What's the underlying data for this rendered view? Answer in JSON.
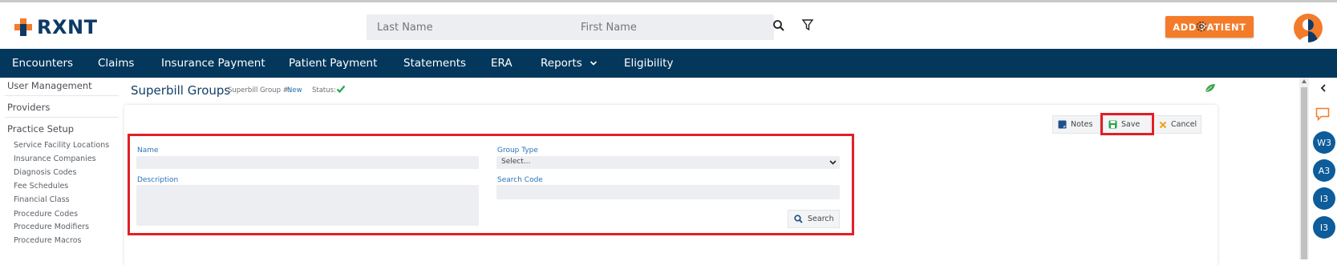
{
  "header": {
    "logo_text": "RXNT",
    "last_name_placeholder": "Last Name",
    "first_name_placeholder": "First Name",
    "add_patient_label": "ADD PATIENT"
  },
  "nav": {
    "items": [
      "Encounters",
      "Claims",
      "Insurance Payment",
      "Patient Payment",
      "Statements",
      "ERA",
      "Reports",
      "Eligibility"
    ]
  },
  "sidebar": {
    "sections": [
      "User Management",
      "Providers",
      "Practice Setup"
    ],
    "sub_items": [
      "Service Facility Locations",
      "Insurance Companies",
      "Diagnosis Codes",
      "Fee Schedules",
      "Financial Class",
      "Procedure Codes",
      "Procedure Modifiers",
      "Procedure Macros"
    ]
  },
  "page": {
    "title": "Superbill Groups",
    "group_num_label": "Superbill Group #:",
    "group_num_value": "New",
    "status_label": "Status:"
  },
  "toolbar": {
    "notes_label": "Notes",
    "save_label": "Save",
    "cancel_label": "Cancel"
  },
  "form": {
    "name_label": "Name",
    "name_value": "",
    "description_label": "Description",
    "description_value": "",
    "group_type_label": "Group Type",
    "group_type_value": "Select...",
    "search_code_label": "Search Code",
    "search_code_value": "",
    "search_button_label": "Search"
  },
  "right_rail": {
    "badges": [
      "W3",
      "A3",
      "I3",
      "I3"
    ]
  },
  "colors": {
    "nav_bg": "#03375c",
    "accent_orange": "#f47b2a",
    "highlight_red": "#e02027",
    "label_blue": "#2a73b8",
    "status_green": "#22a34a"
  }
}
